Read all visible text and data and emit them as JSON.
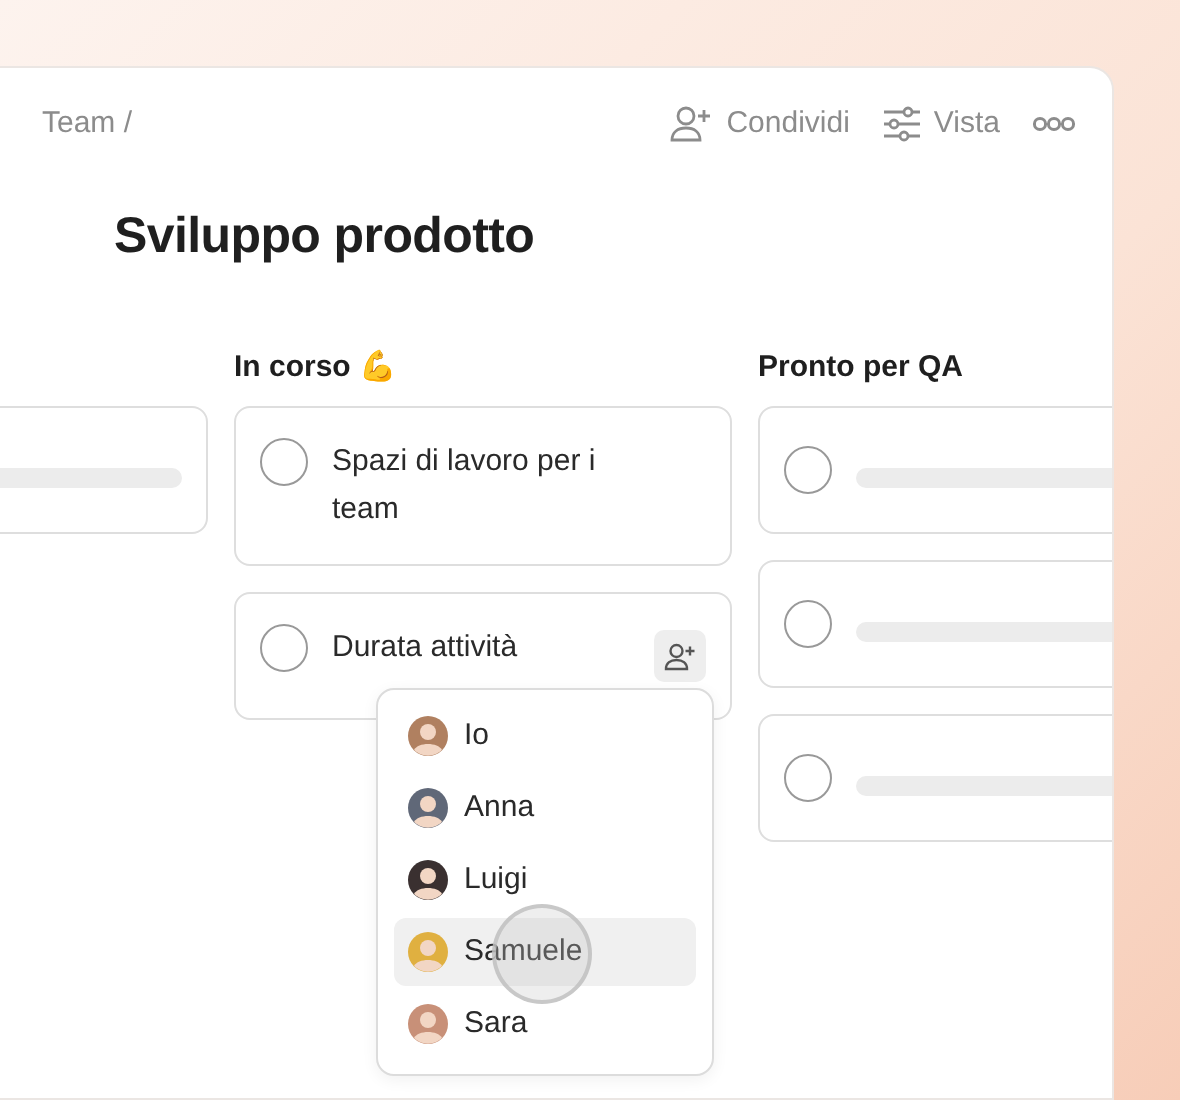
{
  "breadcrumb": "Team /",
  "actions": [
    {
      "kind": "share",
      "label": "Condividi"
    },
    {
      "kind": "view",
      "label": "Vista"
    },
    {
      "kind": "more"
    }
  ],
  "title": "Sviluppo prodotto",
  "columns": [
    {
      "cards": [
        {
          "kind": "placeholder"
        }
      ]
    },
    {
      "title": "In corso 💪",
      "cards": [
        {
          "kind": "task",
          "text": "Spazi di lavoro per i team",
          "checked": false
        },
        {
          "kind": "task",
          "text": "Durata attività",
          "checked": false,
          "assign": true,
          "menu": true
        }
      ]
    },
    {
      "title": "Pronto per QA",
      "cards": [
        {
          "kind": "placeholder"
        },
        {
          "kind": "placeholder"
        },
        {
          "kind": "placeholder"
        }
      ]
    }
  ],
  "assignee_menu": {
    "items": [
      {
        "name": "Io",
        "selected": false
      },
      {
        "name": "Anna",
        "selected": false
      },
      {
        "name": "Luigi",
        "selected": false
      },
      {
        "name": "Samuele",
        "selected": true
      },
      {
        "name": "Sara",
        "selected": false
      }
    ]
  }
}
